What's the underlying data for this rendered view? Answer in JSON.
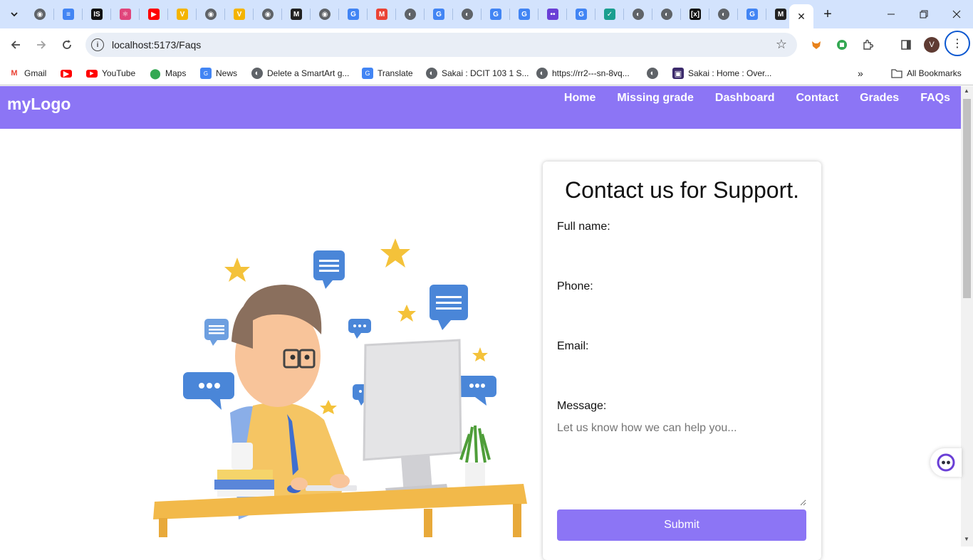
{
  "browser": {
    "active_tab_close": "✕",
    "new_tab": "+",
    "url": "localhost:5173/Faqs",
    "avatar_letter": "V",
    "tab_icons": [
      "chrome-icon",
      "docs-icon",
      "is-icon",
      "react-icon",
      "youtube-icon",
      "v-icon",
      "chrome-icon",
      "v-icon",
      "chrome-icon",
      "m-icon",
      "chrome-icon",
      "google-icon",
      "gmail-icon",
      "globe-icon",
      "google-icon",
      "globe-icon",
      "translate-icon",
      "google-icon",
      "bot-icon",
      "google-icon",
      "check-icon",
      "globe-icon",
      "globe-icon",
      "code-icon",
      "globe-icon",
      "google-icon",
      "m-icon"
    ]
  },
  "bookmarks": {
    "items": [
      {
        "label": "Gmail",
        "icon": "gmail-icon"
      },
      {
        "label": "",
        "icon": "youtube-icon"
      },
      {
        "label": "YouTube",
        "icon": "youtube-icon"
      },
      {
        "label": "Maps",
        "icon": "maps-icon"
      },
      {
        "label": "News",
        "icon": "news-icon"
      },
      {
        "label": "Delete a SmartArt g...",
        "icon": "globe-icon"
      },
      {
        "label": "Translate",
        "icon": "translate-icon"
      },
      {
        "label": "Sakai : DCIT 103 1 S...",
        "icon": "globe-icon"
      },
      {
        "label": "https://rr2---sn-8vq...",
        "icon": "globe-icon"
      },
      {
        "label": "",
        "icon": "globe-icon"
      },
      {
        "label": "Sakai : Home : Over...",
        "icon": "sakai-icon"
      }
    ],
    "more": "»",
    "all_bookmarks": "All Bookmarks"
  },
  "site": {
    "logo": "myLogo",
    "nav": [
      "Home",
      "Missing grade",
      "Dashboard",
      "Contact",
      "Grades",
      "FAQs"
    ]
  },
  "form": {
    "title": "Contact us for Support.",
    "full_name_label": "Full name:",
    "phone_label": "Phone:",
    "email_label": "Email:",
    "message_label": "Message:",
    "message_placeholder": "Let us know how we can help you...",
    "submit_label": "Submit"
  },
  "colors": {
    "brand": "#8c75f5",
    "tabstrip": "#d3e3fd"
  }
}
